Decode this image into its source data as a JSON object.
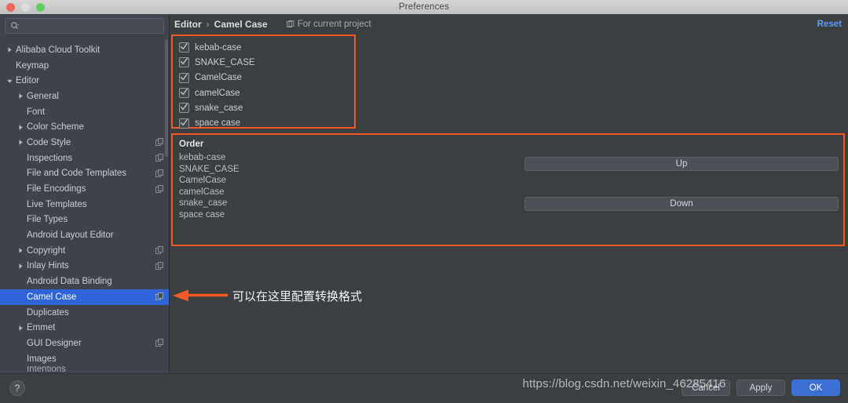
{
  "window": {
    "title": "Preferences",
    "traffic_lights": [
      "close-red",
      "minimize-grey",
      "zoom-green"
    ]
  },
  "sidebar": {
    "search": {
      "value": "",
      "placeholder": ""
    },
    "items": [
      {
        "label": "",
        "indent": 0,
        "arrow": "none",
        "icon": false,
        "selected": false,
        "cut": true
      },
      {
        "label": "Alibaba Cloud Toolkit",
        "indent": 0,
        "arrow": "right",
        "icon": false,
        "selected": false
      },
      {
        "label": "Keymap",
        "indent": 0,
        "arrow": "none",
        "icon": false,
        "selected": false
      },
      {
        "label": "Editor",
        "indent": 0,
        "arrow": "down",
        "icon": false,
        "selected": false
      },
      {
        "label": "General",
        "indent": 1,
        "arrow": "right",
        "icon": false,
        "selected": false
      },
      {
        "label": "Font",
        "indent": 1,
        "arrow": "none",
        "icon": false,
        "selected": false
      },
      {
        "label": "Color Scheme",
        "indent": 1,
        "arrow": "right",
        "icon": false,
        "selected": false
      },
      {
        "label": "Code Style",
        "indent": 1,
        "arrow": "right",
        "icon": true,
        "selected": false
      },
      {
        "label": "Inspections",
        "indent": 1,
        "arrow": "none",
        "icon": true,
        "selected": false
      },
      {
        "label": "File and Code Templates",
        "indent": 1,
        "arrow": "none",
        "icon": true,
        "selected": false
      },
      {
        "label": "File Encodings",
        "indent": 1,
        "arrow": "none",
        "icon": true,
        "selected": false
      },
      {
        "label": "Live Templates",
        "indent": 1,
        "arrow": "none",
        "icon": false,
        "selected": false
      },
      {
        "label": "File Types",
        "indent": 1,
        "arrow": "none",
        "icon": false,
        "selected": false
      },
      {
        "label": "Android Layout Editor",
        "indent": 1,
        "arrow": "none",
        "icon": false,
        "selected": false
      },
      {
        "label": "Copyright",
        "indent": 1,
        "arrow": "right",
        "icon": true,
        "selected": false
      },
      {
        "label": "Inlay Hints",
        "indent": 1,
        "arrow": "right",
        "icon": true,
        "selected": false
      },
      {
        "label": "Android Data Binding",
        "indent": 1,
        "arrow": "none",
        "icon": false,
        "selected": false
      },
      {
        "label": "Camel Case",
        "indent": 1,
        "arrow": "none",
        "icon": true,
        "selected": true
      },
      {
        "label": "Duplicates",
        "indent": 1,
        "arrow": "none",
        "icon": false,
        "selected": false
      },
      {
        "label": "Emmet",
        "indent": 1,
        "arrow": "right",
        "icon": false,
        "selected": false
      },
      {
        "label": "GUI Designer",
        "indent": 1,
        "arrow": "none",
        "icon": true,
        "selected": false
      },
      {
        "label": "Images",
        "indent": 1,
        "arrow": "none",
        "icon": false,
        "selected": false
      },
      {
        "label": "Intentions",
        "indent": 1,
        "arrow": "none",
        "icon": false,
        "selected": false,
        "cut": true
      }
    ]
  },
  "content": {
    "breadcrumb": {
      "parent": "Editor",
      "separator": "›",
      "current": "Camel Case"
    },
    "scope_label": "For current project",
    "reset_label": "Reset",
    "checkboxes": [
      {
        "label": "kebab-case",
        "checked": true
      },
      {
        "label": "SNAKE_CASE",
        "checked": true
      },
      {
        "label": "CamelCase",
        "checked": true
      },
      {
        "label": "camelCase",
        "checked": true
      },
      {
        "label": "snake_case",
        "checked": true
      },
      {
        "label": "space case",
        "checked": true
      }
    ],
    "order": {
      "title": "Order",
      "items": [
        "kebab-case",
        "SNAKE_CASE",
        "CamelCase",
        "camelCase",
        "snake_case",
        "space case"
      ],
      "up_label": "Up",
      "down_label": "Down"
    }
  },
  "annotation": {
    "text": "可以在这里配置转换格式",
    "arrow_color": "#f05a28"
  },
  "footer": {
    "help_label": "?",
    "buttons": [
      {
        "label": "Cancel",
        "primary": false
      },
      {
        "label": "Apply",
        "primary": false
      },
      {
        "label": "OK",
        "primary": true
      }
    ]
  },
  "watermark": {
    "text": "https://blog.csdn.net/weixin_46285416"
  },
  "colors": {
    "highlight": "#f05a28",
    "selection": "#2f63d8",
    "accent_link": "#5b9bf8",
    "content_bg": "#3c3f41",
    "sidebar_bg": "#3f434c"
  }
}
